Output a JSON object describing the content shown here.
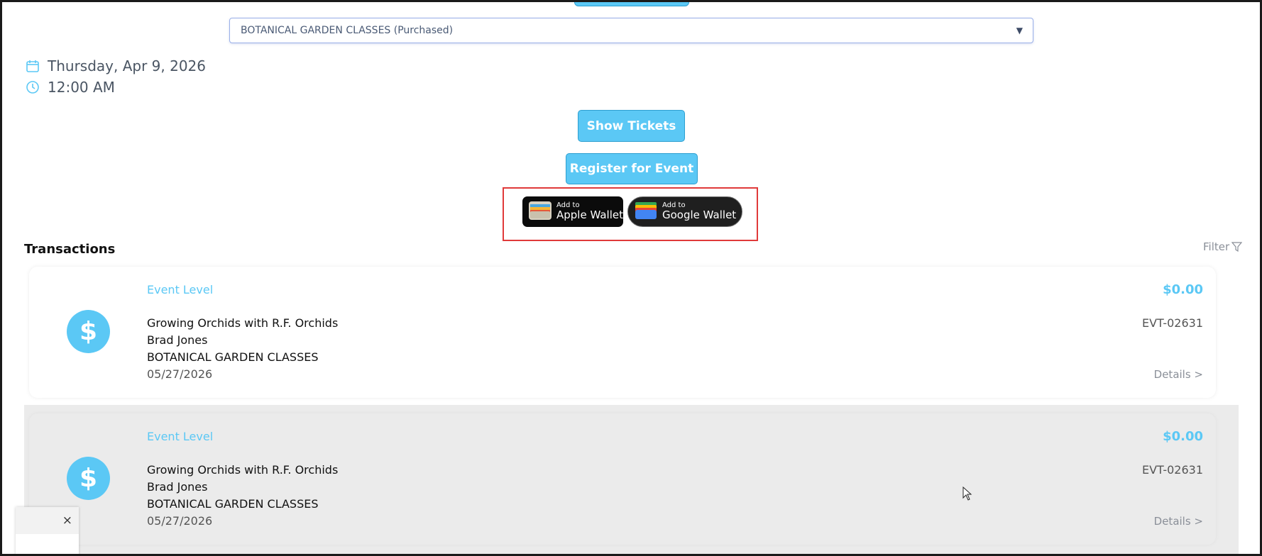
{
  "event_select": {
    "selected_value": "BOTANICAL GARDEN CLASSES (Purchased)"
  },
  "event_info": {
    "date": "Thursday, Apr 9, 2026",
    "time": "12:00 AM"
  },
  "actions": {
    "show_tickets_label": "Show Tickets",
    "register_label": "Register for Event"
  },
  "wallet": {
    "apple_small": "Add to",
    "apple_big": "Apple Wallet",
    "google_small": "Add to",
    "google_big": "Google Wallet"
  },
  "transactions": {
    "title": "Transactions",
    "filter_label": "Filter",
    "items": [
      {
        "level": "Event Level",
        "name": "Growing Orchids with R.F. Orchids",
        "person": "Brad Jones",
        "class": "BOTANICAL GARDEN CLASSES",
        "date": "05/27/2026",
        "amount": "$0.00",
        "id": "EVT-02631",
        "details_label": "Details >"
      },
      {
        "level": "Event Level",
        "name": "Growing Orchids with R.F. Orchids",
        "person": "Brad Jones",
        "class": "BOTANICAL GARDEN CLASSES",
        "date": "05/27/2026",
        "amount": "$0.00",
        "id": "EVT-02631",
        "details_label": "Details >"
      }
    ]
  },
  "popup": {
    "close_glyph": "×"
  },
  "colors": {
    "accent": "#5bc8f5",
    "highlight_border": "#e03a3a"
  }
}
